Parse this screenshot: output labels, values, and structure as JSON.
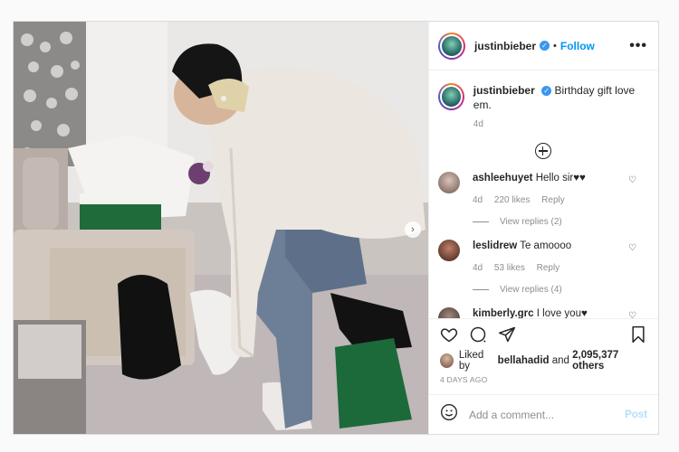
{
  "post": {
    "username": "justinbieber",
    "follow_label": "Follow",
    "more_label": "•••",
    "caption": "Birthday gift love em.",
    "caption_time": "4d",
    "likes_by_user": "bellahadid",
    "likes_and": "and",
    "likes_count": "2,095,377 others",
    "likes_prefix": "Liked by",
    "date": "4 DAYS AGO",
    "comment_placeholder": "Add a comment...",
    "post_label": "Post"
  },
  "comments": [
    {
      "username": "ashleehuyet",
      "text": "Hello sir♥♥",
      "time": "4d",
      "likes": "220 likes",
      "reply_label": "Reply",
      "view_replies": "View replies (2)",
      "avatar_color": "#9a7d78"
    },
    {
      "username": "leslidrew",
      "text": "Te amoooo",
      "time": "4d",
      "likes": "53 likes",
      "reply_label": "Reply",
      "view_replies": "View replies (4)",
      "avatar_color": "#7a3f30"
    },
    {
      "username": "kimberly.grc",
      "text": "I love you♥",
      "avatar_color": "#5c4a44"
    }
  ],
  "icons": {
    "verified": "verified-badge-icon",
    "heart": "heart-icon",
    "comment": "comment-icon",
    "share": "share-icon",
    "save": "bookmark-icon",
    "emoji": "emoji-icon",
    "load_more": "plus-circle-icon",
    "next": "chevron-right-icon"
  },
  "colors": {
    "link_blue": "#0095f6",
    "verified_blue": "#3897f0",
    "muted": "#8e8e8e"
  }
}
